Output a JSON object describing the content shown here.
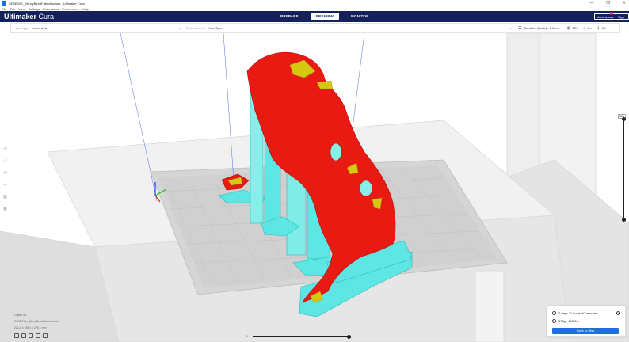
{
  "window": {
    "title": "CE3E3V2_SkinnyBendFabricBosses - Ultimaker Cura",
    "controls": [
      "—",
      "❐",
      "✕"
    ]
  },
  "menu": [
    "File",
    "Edit",
    "View",
    "Settings",
    "Extensions",
    "Preferences",
    "Help"
  ],
  "header": {
    "brand_main": "Ultimaker",
    "brand_sub": "Cura",
    "tabs": [
      {
        "label": "PREPARE",
        "active": false
      },
      {
        "label": "PREVIEW",
        "active": true
      },
      {
        "label": "MONITOR",
        "active": false
      }
    ],
    "marketplace_label": "Marketplace",
    "signin_label": "Sign in"
  },
  "toolbar": {
    "view_type_label": "View type",
    "view_type_value": "Layer view",
    "color_scheme_label": "Color scheme",
    "color_scheme_value": "Line Type",
    "quality_label": "Standard Quality - 0.2mm",
    "infill_value": "15%",
    "support_value": "On",
    "adhesion_value": "On"
  },
  "layer_slider": {
    "top_label": "586",
    "level_fraction": 1.0
  },
  "object_info": {
    "heading": "Object list",
    "filename": "CE3E3V2_SkinnyBendFabricBosses",
    "dimensions": "221.1 x 198.1 x 276.1 mm"
  },
  "print_info": {
    "time": "2 days 11 hours 40 minutes",
    "material": "578g · 196.2m",
    "save_label": "Save to Disk"
  },
  "colors": {
    "header": "#14215a",
    "accent": "#1f6fd6",
    "model_wall": "#e81a12",
    "support": "#5ee6e4",
    "top_skin": "#d4c812"
  },
  "icons": {
    "move": "move-icon",
    "scale": "scale-icon",
    "rotate": "rotate-icon",
    "mirror": "mirror-icon",
    "per_model": "per-model-settings-icon",
    "support_blocker": "support-blocker-icon"
  }
}
